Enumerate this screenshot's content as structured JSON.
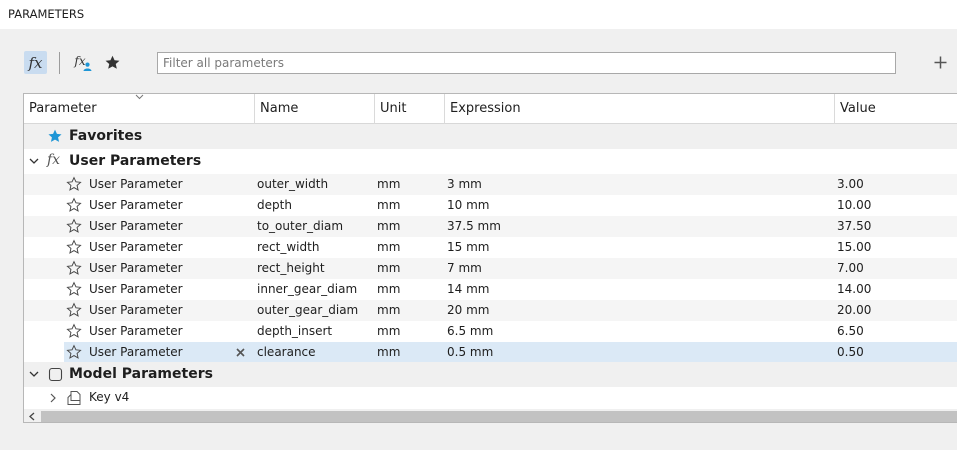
{
  "panel": {
    "title": "PARAMETERS"
  },
  "toolbar": {
    "fx_glyph": "fx",
    "fxu_glyph": "fx",
    "filter_placeholder": "Filter all parameters",
    "add_glyph": "+"
  },
  "columns": {
    "parameter": "Parameter",
    "name": "Name",
    "unit": "Unit",
    "expression": "Expression",
    "value": "Value"
  },
  "groups": {
    "favorites": "Favorites",
    "user": "User Parameters",
    "model": "Model Parameters",
    "model_child": "Key v4"
  },
  "rows": [
    {
      "parameter": "User Parameter",
      "name": "outer_width",
      "unit": "mm",
      "expression": "3 mm",
      "value": "3.00"
    },
    {
      "parameter": "User Parameter",
      "name": "depth",
      "unit": "mm",
      "expression": "10 mm",
      "value": "10.00"
    },
    {
      "parameter": "User Parameter",
      "name": "to_outer_diam",
      "unit": "mm",
      "expression": "37.5 mm",
      "value": "37.50"
    },
    {
      "parameter": "User Parameter",
      "name": "rect_width",
      "unit": "mm",
      "expression": "15 mm",
      "value": "15.00"
    },
    {
      "parameter": "User Parameter",
      "name": "rect_height",
      "unit": "mm",
      "expression": "7 mm",
      "value": "7.00"
    },
    {
      "parameter": "User Parameter",
      "name": "inner_gear_diam",
      "unit": "mm",
      "expression": "14 mm",
      "value": "14.00"
    },
    {
      "parameter": "User Parameter",
      "name": "outer_gear_diam",
      "unit": "mm",
      "expression": "20 mm",
      "value": "20.00"
    },
    {
      "parameter": "User Parameter",
      "name": "depth_insert",
      "unit": "mm",
      "expression": "6.5 mm",
      "value": "6.50"
    },
    {
      "parameter": "User Parameter",
      "name": "clearance",
      "unit": "mm",
      "expression": "0.5 mm",
      "value": "0.50"
    }
  ],
  "colors": {
    "accent": "#1e96d6",
    "selected_row": "#dbe9f6",
    "fx_button": "#c9dcf0"
  }
}
